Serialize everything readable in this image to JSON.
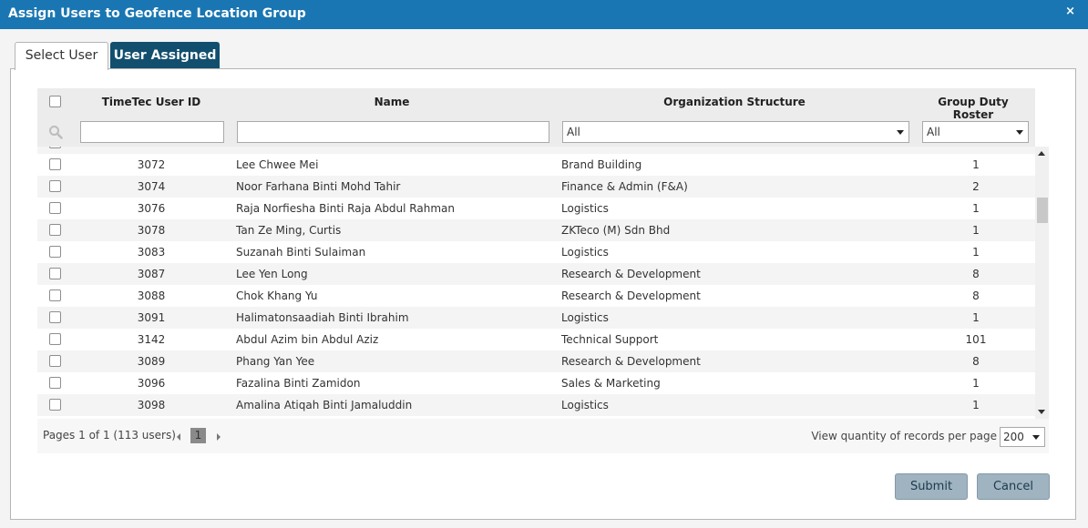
{
  "dialog": {
    "title": "Assign Users to Geofence Location Group",
    "close_symbol": "×"
  },
  "tabs": [
    {
      "label": "Select User",
      "active": true
    },
    {
      "label": "User Assigned",
      "active": false
    }
  ],
  "grid": {
    "columns": {
      "id": "TimeTec User ID",
      "name": "Name",
      "org": "Organization Structure",
      "gdr": "Group Duty Roster"
    },
    "filters": {
      "id_value": "",
      "name_value": "",
      "org_selected": "All",
      "gdr_selected": "All"
    },
    "rows": [
      {
        "id": "3072",
        "name": "Lee Chwee Mei",
        "org": "Brand Building",
        "gdr": "1"
      },
      {
        "id": "3074",
        "name": "Noor Farhana Binti Mohd Tahir",
        "org": "Finance & Admin (F&A)",
        "gdr": "2"
      },
      {
        "id": "3076",
        "name": "Raja Norfiesha Binti Raja Abdul Rahman",
        "org": "Logistics",
        "gdr": "1"
      },
      {
        "id": "3078",
        "name": "Tan Ze Ming, Curtis",
        "org": "ZKTeco (M) Sdn Bhd",
        "gdr": "1"
      },
      {
        "id": "3083",
        "name": "Suzanah Binti Sulaiman",
        "org": "Logistics",
        "gdr": "1"
      },
      {
        "id": "3087",
        "name": "Lee Yen Long",
        "org": "Research & Development",
        "gdr": "8"
      },
      {
        "id": "3088",
        "name": "Chok Khang Yu",
        "org": "Research & Development",
        "gdr": "8"
      },
      {
        "id": "3091",
        "name": "Halimatonsaadiah Binti Ibrahim",
        "org": "Logistics",
        "gdr": "1"
      },
      {
        "id": "3142",
        "name": "Abdul Azim bin Abdul Aziz",
        "org": "Technical Support",
        "gdr": "101"
      },
      {
        "id": "3089",
        "name": "Phang Yan Yee",
        "org": "Research & Development",
        "gdr": "8"
      },
      {
        "id": "3096",
        "name": "Fazalina Binti Zamidon",
        "org": "Sales & Marketing",
        "gdr": "1"
      },
      {
        "id": "3098",
        "name": "Amalina Atiqah Binti Jamaluddin",
        "org": "Logistics",
        "gdr": "1"
      }
    ]
  },
  "pager": {
    "info": "Pages 1 of 1 (113 users)",
    "current_page": "1",
    "per_page_label": "View quantity of records per page",
    "per_page_value": "200"
  },
  "buttons": {
    "submit": "Submit",
    "cancel": "Cancel"
  },
  "colors": {
    "titlebar": "#1976b2",
    "active_tab": "#124f6e",
    "button": "#9fb3c0"
  }
}
